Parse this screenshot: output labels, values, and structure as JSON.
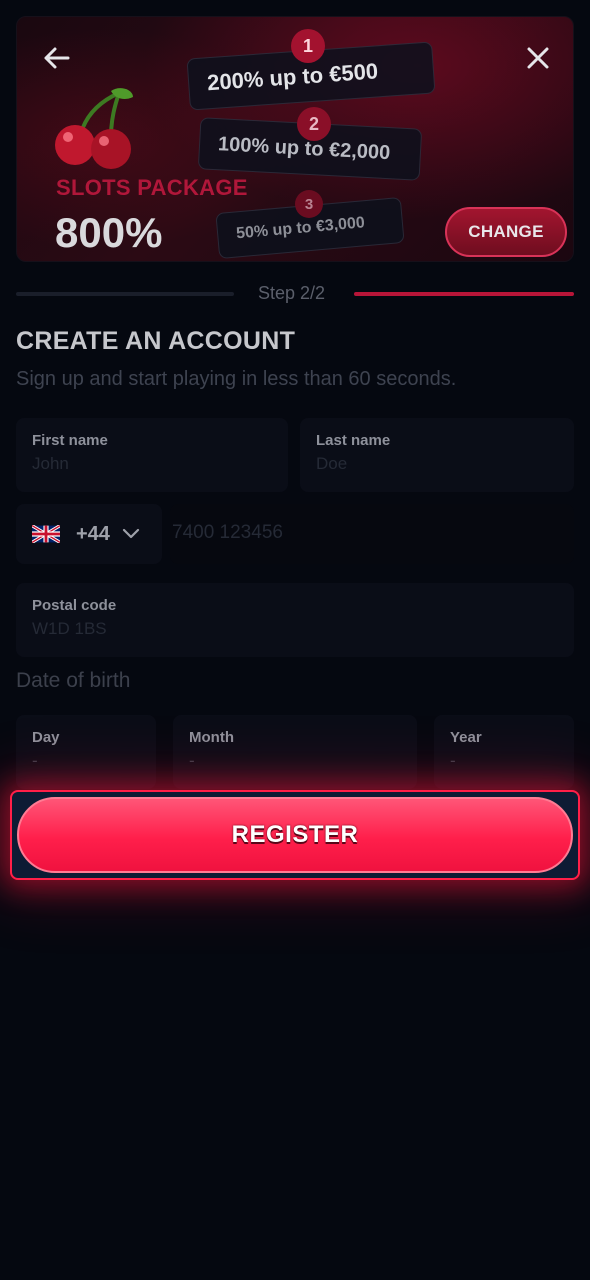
{
  "bonus": {
    "package_label": "SLOTS PACKAGE",
    "package_percent": "800%",
    "tiers": [
      {
        "number": "1",
        "text": "200% up to €500"
      },
      {
        "number": "2",
        "text": "100% up to €2,000"
      },
      {
        "number": "3",
        "text": "50% up to €3,000"
      }
    ],
    "change_label": "CHANGE"
  },
  "step": {
    "text": "Step 2/2"
  },
  "form": {
    "heading": "CREATE AN ACCOUNT",
    "subheading": "Sign up and start playing in less than 60 seconds.",
    "first_name": {
      "label": "First name",
      "placeholder": "John",
      "value": ""
    },
    "last_name": {
      "label": "Last name",
      "placeholder": "Doe",
      "value": ""
    },
    "phone": {
      "dial_code": "+44",
      "country_flag": "uk-flag-icon",
      "placeholder": "7400 123456",
      "value": ""
    },
    "postal_code": {
      "label": "Postal code",
      "placeholder": "W1D 1BS",
      "value": ""
    },
    "dob_label": "Date of birth",
    "day": {
      "label": "Day",
      "value": "-"
    },
    "month": {
      "label": "Month",
      "value": "-"
    },
    "year": {
      "label": "Year",
      "value": "-"
    }
  },
  "register_label": "REGISTER",
  "colors": {
    "accent": "#ff1f4b",
    "background": "#050810",
    "package_label": "#b0173a"
  }
}
